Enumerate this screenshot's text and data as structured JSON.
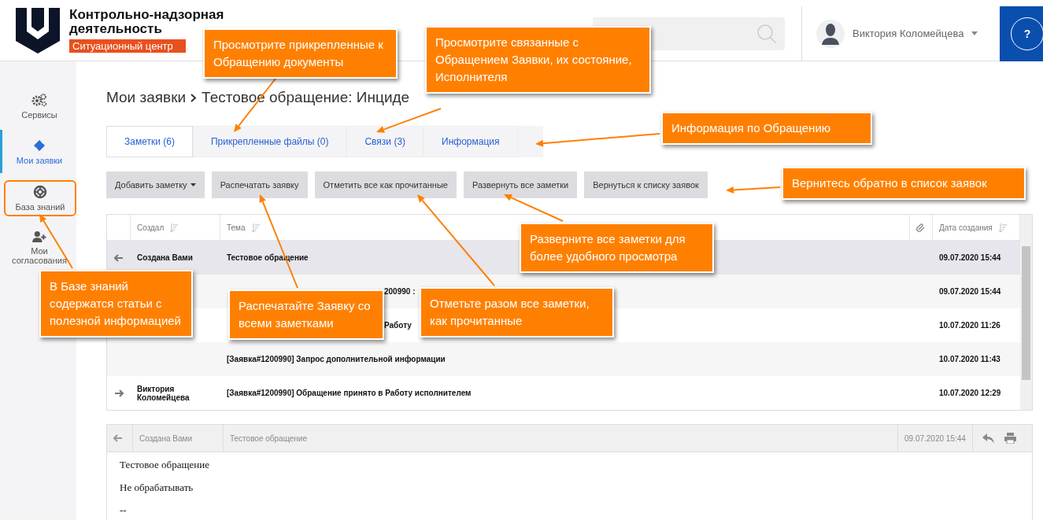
{
  "header": {
    "title_lines": [
      "Контрольно-надзорная",
      "деятельность"
    ],
    "tag": "Ситуационный центр",
    "user_name": "Виктория Коломейцева",
    "help": "?"
  },
  "sidebar": {
    "items": [
      {
        "label": "Сервисы",
        "selected": false,
        "highlighted": false
      },
      {
        "label": "Мои заявки",
        "selected": true,
        "highlighted": false
      },
      {
        "label": "База знаний",
        "selected": false,
        "highlighted": true
      },
      {
        "label": "Мои согласования",
        "selected": false,
        "highlighted": false
      }
    ]
  },
  "breadcrumb": {
    "parent": "Мои заявки",
    "current": "Тестовое обращение: Инциде"
  },
  "tabs": [
    {
      "label": "Заметки (6)",
      "selected": true
    },
    {
      "label": "Прикрепленные файлы (0)",
      "selected": false
    },
    {
      "label": "Связи (3)",
      "selected": false
    },
    {
      "label": "Информация",
      "selected": false
    }
  ],
  "buttons": [
    {
      "label": "Добавить заметку",
      "dropdown": true
    },
    {
      "label": "Распечатать заявку",
      "dropdown": false
    },
    {
      "label": "Отметить все как прочитанные",
      "dropdown": false
    },
    {
      "label": "Развернуть все заметки",
      "dropdown": false
    },
    {
      "label": "Вернуться к списку заявок",
      "dropdown": false
    }
  ],
  "table": {
    "columns": [
      "Создал",
      "Тема",
      "Дата создания"
    ],
    "rows": [
      {
        "kind": "incoming",
        "creator": "Создана Вами",
        "theme": "Тестовое обращение",
        "date": "09.07.2020 15:44",
        "selected": true
      },
      {
        "kind": "plain",
        "theme_tail": "200990 :",
        "date": "09.07.2020 15:44",
        "selected": false
      },
      {
        "kind": "plain",
        "theme_tail": "Работу",
        "date": "10.07.2020 11:26",
        "selected": false
      },
      {
        "kind": "plain",
        "theme": "[Заявка#1200990] Запрос дополнительной информации",
        "date": "10.07.2020 11:43",
        "selected": false
      },
      {
        "kind": "outgoing",
        "creator": "Виктория Коломейцева",
        "theme": "[Заявка#1200990] Обращение принято в Работу исполнителем",
        "date": "10.07.2020 12:29",
        "selected": false
      }
    ]
  },
  "detail": {
    "creator": "Создана Вами",
    "theme": "Тестовое обращение",
    "date": "09.07.2020 15:44",
    "body": [
      "Тестовое обращение",
      "Не обрабатывать",
      "--"
    ]
  },
  "callouts": [
    {
      "text": "Просмотрите прикрепленные к Обращению документы"
    },
    {
      "text": "Просмотрите связанные с Обращением Заявки, их состояние, Исполнителя"
    },
    {
      "text": "Информация по Обращению"
    },
    {
      "text": "Вернитесь обратно в список заявок"
    },
    {
      "text": "Разверните все заметки для более удобного просмотра"
    },
    {
      "text": "В Базе знаний содержатся статьи с полезной информацией"
    },
    {
      "text": "Распечатайте Заявку со всеми заметками"
    },
    {
      "text": "Отметьте разом все заметки, как прочитанные"
    }
  ]
}
